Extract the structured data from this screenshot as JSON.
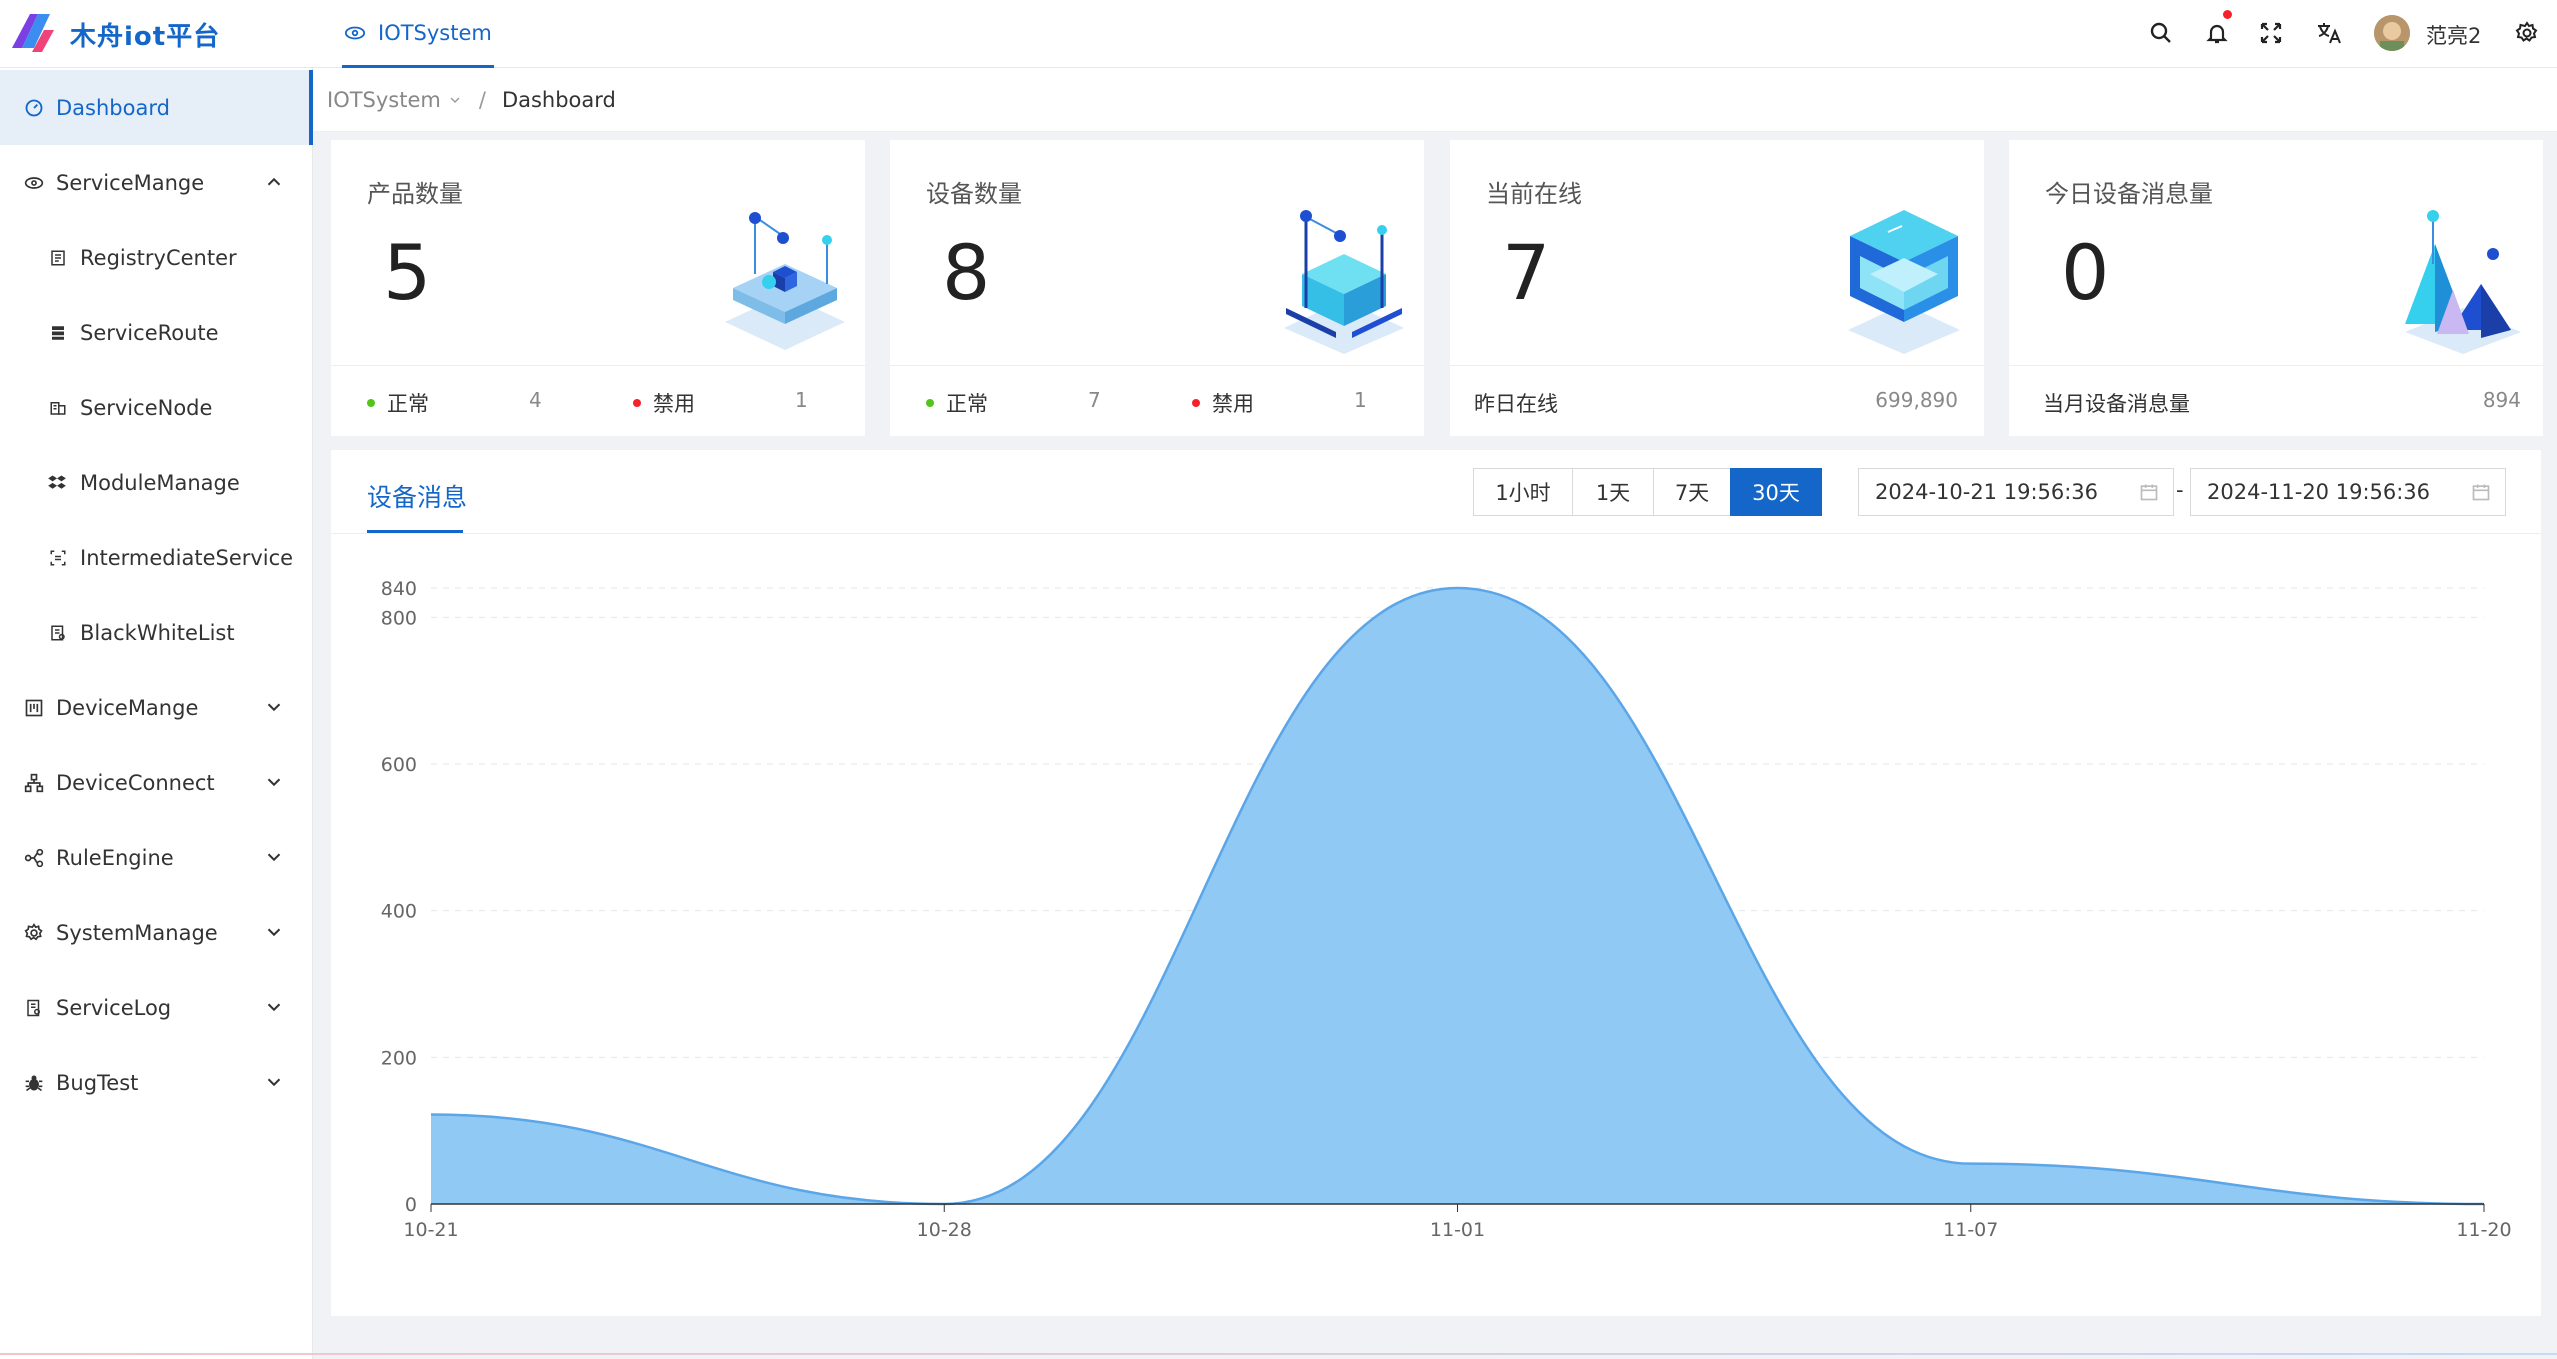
{
  "app": {
    "title": "木舟iot平台"
  },
  "header": {
    "top_tab": {
      "label": "IOTSystem",
      "icon": "system-icon"
    },
    "icons": [
      "search-icon",
      "bell-icon",
      "fullscreen-icon",
      "translate-icon",
      "settings-icon"
    ],
    "user": {
      "name": "范亮2"
    }
  },
  "sidebar": {
    "items": [
      {
        "label": "Dashboard",
        "icon": "dashboard-icon",
        "level": 1,
        "active": true
      },
      {
        "label": "ServiceMange",
        "icon": "service-icon",
        "level": 1,
        "expanded": true
      },
      {
        "label": "RegistryCenter",
        "icon": "registry-icon",
        "level": 2
      },
      {
        "label": "ServiceRoute",
        "icon": "route-icon",
        "level": 2
      },
      {
        "label": "ServiceNode",
        "icon": "node-icon",
        "level": 2
      },
      {
        "label": "ModuleManage",
        "icon": "module-icon",
        "level": 2
      },
      {
        "label": "IntermediateService",
        "icon": "intermediate-icon",
        "level": 2
      },
      {
        "label": "BlackWhiteList",
        "icon": "list-icon",
        "level": 2
      },
      {
        "label": "DeviceMange",
        "icon": "device-icon",
        "level": 1,
        "expanded": false
      },
      {
        "label": "DeviceConnect",
        "icon": "connect-icon",
        "level": 1,
        "expanded": false
      },
      {
        "label": "RuleEngine",
        "icon": "rule-icon",
        "level": 1,
        "expanded": false
      },
      {
        "label": "SystemManage",
        "icon": "gear-icon",
        "level": 1,
        "expanded": false
      },
      {
        "label": "ServiceLog",
        "icon": "log-icon",
        "level": 1,
        "expanded": false
      },
      {
        "label": "BugTest",
        "icon": "bug-icon",
        "level": 1,
        "expanded": false
      }
    ]
  },
  "breadcrumb": {
    "root": "IOTSystem",
    "separator": "/",
    "current": "Dashboard"
  },
  "cards": [
    {
      "title": "产品数量",
      "value": "5",
      "left_label": "正常",
      "left_count": "4",
      "right_label": "禁用",
      "right_count": "1"
    },
    {
      "title": "设备数量",
      "value": "8",
      "left_label": "正常",
      "left_count": "7",
      "right_label": "禁用",
      "right_count": "1"
    },
    {
      "title": "当前在线",
      "value": "7",
      "foot_label": "昨日在线",
      "foot_value": "699,890"
    },
    {
      "title": "今日设备消息量",
      "value": "0",
      "foot_label": "当月设备消息量",
      "foot_value": "894"
    }
  ],
  "panel": {
    "tab": "设备消息",
    "ranges": [
      "1小时",
      "1天",
      "7天",
      "30天"
    ],
    "active_range": "30天",
    "date_start": "2024-10-21 19:56:36",
    "date_end": "2024-11-20 19:56:36",
    "date_separator": "-"
  },
  "colors": {
    "accent": "#1467c8",
    "area_fill": "#8ac6f2",
    "area_line": "#5aa6e8",
    "ok": "#52c41a",
    "disabled": "#f5222d"
  },
  "chart_data": {
    "type": "area",
    "title": "",
    "xlabel": "",
    "ylabel": "",
    "x_ticks": [
      "10-21",
      "10-28",
      "11-01",
      "11-07",
      "11-20"
    ],
    "y_ticks": [
      0,
      200,
      400,
      600,
      800,
      840
    ],
    "ylim": [
      0,
      840
    ],
    "x": [
      "10-21",
      "10-28",
      "11-01",
      "11-07",
      "11-20"
    ],
    "y": [
      122,
      0,
      840,
      55,
      0
    ],
    "smooth": true,
    "grid": true
  }
}
